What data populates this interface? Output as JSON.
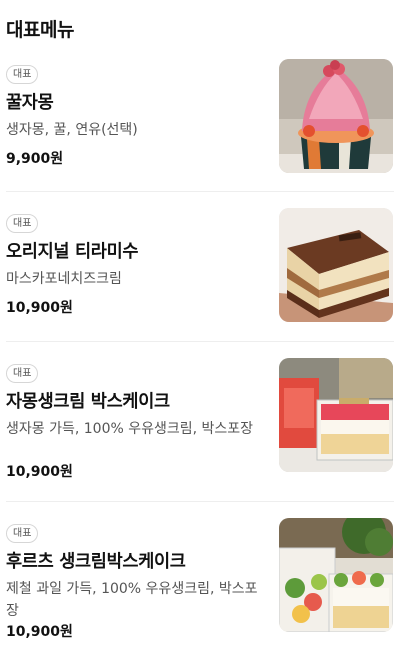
{
  "section": {
    "title": "대표메뉴"
  },
  "items": [
    {
      "badge": "대표",
      "name": "꿀자몽",
      "description": "생자몽, 꿀, 연유(선택)",
      "price": "9,900원",
      "image_icon": "grapefruit-bingsu-photo"
    },
    {
      "badge": "대표",
      "name": "오리지널 티라미수",
      "description": "마스카포네치즈크림",
      "price": "10,900원",
      "image_icon": "tiramisu-photo"
    },
    {
      "badge": "대표",
      "name": "자몽생크림 박스케이크",
      "description": "생자몽 가득, 100% 우유생크림, 박스포장",
      "price": "10,900원",
      "image_icon": "grapefruit-box-cake-photo"
    },
    {
      "badge": "대표",
      "name": "후르츠 생크림박스케이크",
      "description": "제철 과일 가득, 100% 우유생크림, 박스포장",
      "price": "10,900원",
      "image_icon": "fruit-box-cake-photo"
    }
  ]
}
